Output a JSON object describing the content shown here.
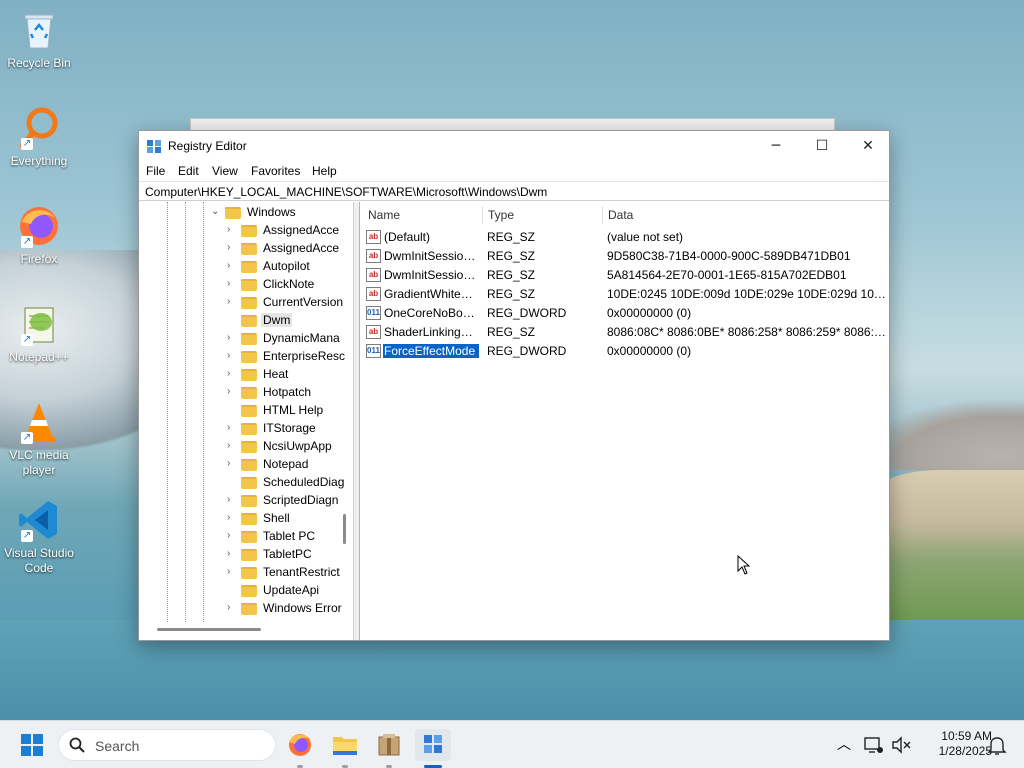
{
  "desktop": {
    "icons": [
      {
        "label": "Recycle Bin",
        "icon": "recycle-bin-icon"
      },
      {
        "label": "Everything",
        "icon": "everything-search-icon"
      },
      {
        "label": "Firefox",
        "icon": "firefox-icon"
      },
      {
        "label": "Notepad++",
        "icon": "notepad-plus-plus-icon"
      },
      {
        "label": "VLC media player",
        "icon": "vlc-icon"
      },
      {
        "label": "Visual Studio Code",
        "icon": "vscode-icon"
      }
    ]
  },
  "window": {
    "title": "Registry Editor",
    "controls": {
      "minimize": "─",
      "maximize": "☐",
      "close": "✕"
    },
    "menu": [
      "File",
      "Edit",
      "View",
      "Favorites",
      "Help"
    ],
    "address": "Computer\\HKEY_LOCAL_MACHINE\\SOFTWARE\\Microsoft\\Windows\\Dwm",
    "tree": {
      "parent": "Windows",
      "items": [
        {
          "label": "AssignedAcce",
          "expandable": true
        },
        {
          "label": "AssignedAcce",
          "expandable": true
        },
        {
          "label": "Autopilot",
          "expandable": true
        },
        {
          "label": "ClickNote",
          "expandable": true
        },
        {
          "label": "CurrentVersion",
          "expandable": true
        },
        {
          "label": "Dwm",
          "expandable": false,
          "selected": true
        },
        {
          "label": "DynamicMana",
          "expandable": true
        },
        {
          "label": "EnterpriseResc",
          "expandable": true
        },
        {
          "label": "Heat",
          "expandable": true
        },
        {
          "label": "Hotpatch",
          "expandable": true
        },
        {
          "label": "HTML Help",
          "expandable": false
        },
        {
          "label": "ITStorage",
          "expandable": true
        },
        {
          "label": "NcsiUwpApp",
          "expandable": true
        },
        {
          "label": "Notepad",
          "expandable": true
        },
        {
          "label": "ScheduledDiag",
          "expandable": false
        },
        {
          "label": "ScriptedDiagn",
          "expandable": true
        },
        {
          "label": "Shell",
          "expandable": true
        },
        {
          "label": "Tablet PC",
          "expandable": true
        },
        {
          "label": "TabletPC",
          "expandable": true
        },
        {
          "label": "TenantRestrict",
          "expandable": true
        },
        {
          "label": "UpdateApi",
          "expandable": false
        },
        {
          "label": "Windows Error",
          "expandable": true
        }
      ]
    },
    "columns": {
      "name": "Name",
      "type": "Type",
      "data": "Data"
    },
    "values": [
      {
        "name": "(Default)",
        "type": "REG_SZ",
        "data": "(value not set)",
        "kind": "string"
      },
      {
        "name": "DwmInitSession...",
        "type": "REG_SZ",
        "data": "9D580C38-71B4-0000-900C-589DB471DB01",
        "kind": "string"
      },
      {
        "name": "DwmInitSession...",
        "type": "REG_SZ",
        "data": "5A814564-2E70-0001-1E65-815A702EDB01",
        "kind": "string"
      },
      {
        "name": "GradientWhitePi...",
        "type": "REG_SZ",
        "data": "10DE:0245 10DE:009d 10DE:029e 10DE:029d 10DE:02...",
        "kind": "string"
      },
      {
        "name": "OneCoreNoBoo...",
        "type": "REG_DWORD",
        "data": "0x00000000 (0)",
        "kind": "binary"
      },
      {
        "name": "ShaderLinkingG...",
        "type": "REG_SZ",
        "data": "8086:08C* 8086:0BE* 8086:258* 8086:259* 8086:277*...",
        "kind": "string"
      },
      {
        "name": "ForceEffectMode",
        "type": "REG_DWORD",
        "data": "0x00000000 (0)",
        "kind": "binary",
        "selected": true
      }
    ]
  },
  "taskbar": {
    "search_placeholder": "Search",
    "apps": [
      "firefox-icon",
      "file-explorer-icon",
      "package-icon",
      "registry-editor-icon"
    ],
    "clock": {
      "time": "10:59 AM",
      "date": "1/28/2025"
    }
  },
  "colors": {
    "selection": "#0a64c8",
    "folder": "#f3c64b"
  }
}
